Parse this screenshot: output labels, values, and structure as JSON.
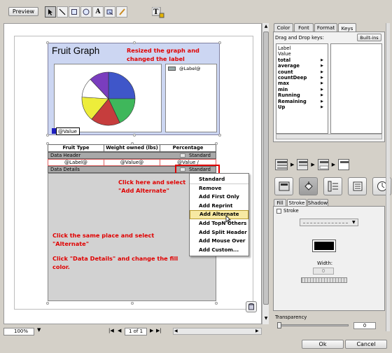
{
  "toolbar": {
    "preview_label": "Preview"
  },
  "chart": {
    "title": "Fruit Graph",
    "legend_label": "@Label@",
    "value_label": "@Value"
  },
  "table": {
    "headers": [
      "Fruit Type",
      "Weight owned (lbs)",
      "Percentage"
    ],
    "data_header_label": "Data Header",
    "data_header_style": "Standard",
    "row_values": [
      "@Label@",
      "@Value@",
      "@Value /"
    ],
    "data_details_label": "Data Details",
    "data_details_style": "Standard"
  },
  "context_menu": {
    "items": [
      "Standard",
      "Remove",
      "Add First Only",
      "Add Reprint",
      "Add Alternate",
      "Add TopN Others",
      "Add Split Header",
      "Add Mouse Over",
      "Add Custom..."
    ],
    "highlighted_index": 4
  },
  "annotations": {
    "resize": "Resized the graph and\nchanged the label",
    "click_here": "Click here and select\n\"Add Alternate\"",
    "same_place": "Click the same place and select\n\"Alternate\"",
    "data_details": "Click \"Data Details\" and change the fill\ncolor."
  },
  "statusbar": {
    "zoom": "100%",
    "page": "1 of 1"
  },
  "right_panel": {
    "tabs": [
      "Color",
      "Font",
      "Format",
      "Keys"
    ],
    "active_tab": "Keys",
    "drag_drop_label": "Drag and Drop keys:",
    "builtins_label": "Built-ins",
    "keys": [
      {
        "label": "Label",
        "bold": false,
        "arrow": false
      },
      {
        "label": "Value",
        "bold": false,
        "arrow": false
      },
      {
        "label": "total",
        "bold": true,
        "arrow": true
      },
      {
        "label": "average",
        "bold": true,
        "arrow": true
      },
      {
        "label": "count",
        "bold": true,
        "arrow": true
      },
      {
        "label": "countDeep",
        "bold": true,
        "arrow": true
      },
      {
        "label": "max",
        "bold": true,
        "arrow": true
      },
      {
        "label": "min",
        "bold": true,
        "arrow": true
      },
      {
        "label": "Running",
        "bold": true,
        "arrow": true
      },
      {
        "label": "Remaining",
        "bold": true,
        "arrow": true
      },
      {
        "label": "Up",
        "bold": true,
        "arrow": true
      }
    ],
    "style_tabs": [
      "Fill",
      "Stroke",
      "Shadow"
    ],
    "active_style_tab": "Stroke",
    "stroke_checkbox_label": "Stroke",
    "width_label": "Width:",
    "width_value": "0",
    "transparency_label": "Transparency",
    "transparency_value": "0"
  },
  "dialog_buttons": {
    "ok": "Ok",
    "cancel": "Cancel"
  },
  "colors": {
    "chart_bg": "#ccd6f2",
    "pie": [
      "#3f56c9",
      "#3fb75b",
      "#c63d3d",
      "#eded3a",
      "#ffffff",
      "#7a3dbe"
    ]
  }
}
